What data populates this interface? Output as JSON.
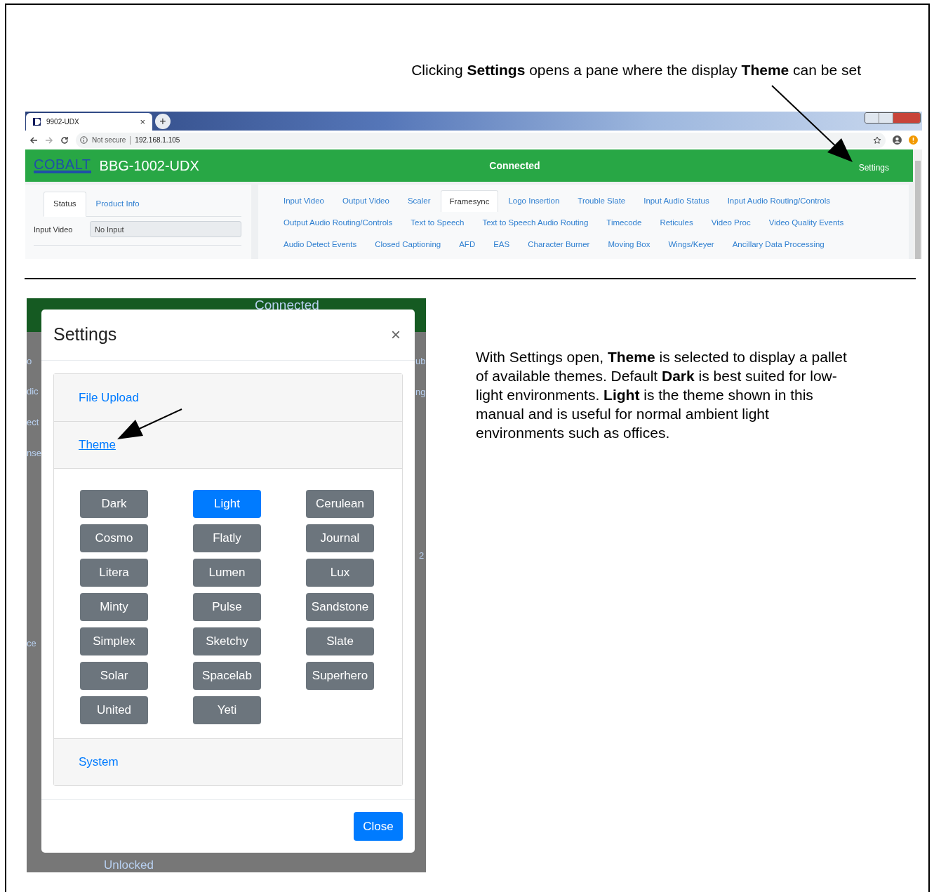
{
  "callout_top": "Clicking **Settings** opens a pane where the display **Theme** can be set",
  "browser": {
    "tab_title": "9902-UDX",
    "tab_close": "×",
    "new_tab": "+",
    "security": "Not secure",
    "url": "192.168.1.105",
    "app": {
      "logo": "COBALT",
      "device": "BBG-1002-UDX",
      "status": "Connected",
      "settings_link": "Settings",
      "left_tabs": [
        {
          "label": "Status",
          "selected": true
        },
        {
          "label": "Product Info",
          "selected": false
        }
      ],
      "fields": [
        {
          "label": "Input Video",
          "value": "No Input"
        }
      ],
      "nav_rows": [
        [
          {
            "label": "Input Video",
            "selected": false
          },
          {
            "label": "Output Video",
            "selected": false
          },
          {
            "label": "Scaler",
            "selected": false
          },
          {
            "label": "Framesync",
            "selected": true
          },
          {
            "label": "Logo Insertion",
            "selected": false
          },
          {
            "label": "Trouble Slate",
            "selected": false
          },
          {
            "label": "Input Audio Status",
            "selected": false
          },
          {
            "label": "Input Audio Routing/Controls",
            "selected": false
          }
        ],
        [
          {
            "label": "Output Audio Routing/Controls",
            "selected": false
          },
          {
            "label": "Text to Speech",
            "selected": false
          },
          {
            "label": "Text to Speech Audio Routing",
            "selected": false
          },
          {
            "label": "Timecode",
            "selected": false
          },
          {
            "label": "Reticules",
            "selected": false
          },
          {
            "label": "Video Proc",
            "selected": false
          },
          {
            "label": "Video Quality Events",
            "selected": false
          }
        ],
        [
          {
            "label": "Audio Detect Events",
            "selected": false
          },
          {
            "label": "Closed Captioning",
            "selected": false
          },
          {
            "label": "AFD",
            "selected": false
          },
          {
            "label": "EAS",
            "selected": false
          },
          {
            "label": "Character Burner",
            "selected": false
          },
          {
            "label": "Moving Box",
            "selected": false
          },
          {
            "label": "Wings/Keyer",
            "selected": false
          },
          {
            "label": "Ancillary Data Processing",
            "selected": false
          }
        ]
      ]
    }
  },
  "settings_shot": {
    "backdrop_texts": [
      "Connected",
      "o",
      "dic",
      "ect",
      "nse",
      "ce",
      "ub",
      "ng",
      "2",
      "Unlocked"
    ],
    "modal": {
      "title": "Settings",
      "close_icon": "×",
      "sections": [
        {
          "label": "File Upload",
          "expanded": false
        },
        {
          "label": "Theme",
          "expanded": true
        },
        {
          "label": "System",
          "expanded": false
        }
      ],
      "themes": [
        {
          "label": "Dark",
          "selected": false
        },
        {
          "label": "Light",
          "selected": true
        },
        {
          "label": "Cerulean",
          "selected": false
        },
        {
          "label": "Cosmo",
          "selected": false
        },
        {
          "label": "Flatly",
          "selected": false
        },
        {
          "label": "Journal",
          "selected": false
        },
        {
          "label": "Litera",
          "selected": false
        },
        {
          "label": "Lumen",
          "selected": false
        },
        {
          "label": "Lux",
          "selected": false
        },
        {
          "label": "Minty",
          "selected": false
        },
        {
          "label": "Pulse",
          "selected": false
        },
        {
          "label": "Sandstone",
          "selected": false
        },
        {
          "label": "Simplex",
          "selected": false
        },
        {
          "label": "Sketchy",
          "selected": false
        },
        {
          "label": "Slate",
          "selected": false
        },
        {
          "label": "Solar",
          "selected": false
        },
        {
          "label": "Spacelab",
          "selected": false
        },
        {
          "label": "Superhero",
          "selected": false
        },
        {
          "label": "United",
          "selected": false
        },
        {
          "label": "Yeti",
          "selected": false
        }
      ],
      "close_button": "Close"
    }
  },
  "callout_right": "With Settings open, **Theme** is selected to display a pallet of available themes. Default **Dark** is best suited for low-light environments. **Light** is the theme shown in this manual and is useful for normal ambient light environments such as offices."
}
